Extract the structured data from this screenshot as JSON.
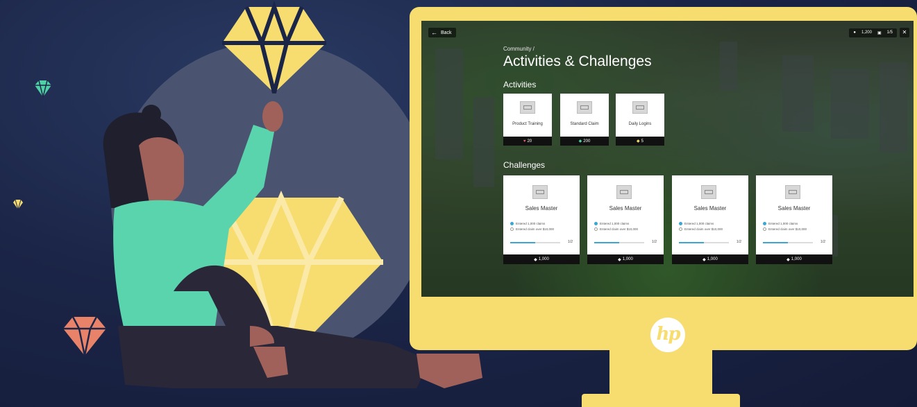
{
  "header": {
    "back_label": "Back",
    "coins": "1,200",
    "messages": "1/5",
    "close_label": "✕"
  },
  "breadcrumb": "Community /",
  "title": "Activities & Challenges",
  "activities": {
    "heading": "Activities",
    "items": [
      {
        "name": "Product Training",
        "reward": "20",
        "icon": "heart-icon",
        "color": "#e06a6a"
      },
      {
        "name": "Standard Claim",
        "reward": "200",
        "icon": "gem-icon",
        "color": "#4fd1a5"
      },
      {
        "name": "Daily Logins",
        "reward": "5",
        "icon": "gem-icon",
        "color": "#f7dc6f"
      }
    ]
  },
  "challenges": {
    "heading": "Challenges",
    "items": [
      {
        "name": "Sales Master",
        "req1": "Entered 1,000 claims",
        "req2": "Entered claim over $10,000",
        "progress": "1/2",
        "progress_fraction": 0.5,
        "reward": "1,000"
      },
      {
        "name": "Sales Master",
        "req1": "Entered 1,000 claims",
        "req2": "Entered claim over $10,000",
        "progress": "1/2",
        "progress_fraction": 0.5,
        "reward": "1,000"
      },
      {
        "name": "Sales Master",
        "req1": "Entered 1,000 claims",
        "req2": "Entered claim over $10,000",
        "progress": "1/2",
        "progress_fraction": 0.5,
        "reward": "1,000"
      },
      {
        "name": "Sales Master",
        "req1": "Entered 1,000 claims",
        "req2": "Entered claim over $10,000",
        "progress": "1/2",
        "progress_fraction": 0.5,
        "reward": "1,000"
      }
    ]
  },
  "brand": {
    "logo_text": "hp",
    "monitor_color": "#f7dc6f"
  },
  "colors": {
    "background": "#1b2547",
    "accent_yellow": "#f7dc6f",
    "accent_teal": "#4fd1a5",
    "accent_coral": "#e8836a"
  }
}
